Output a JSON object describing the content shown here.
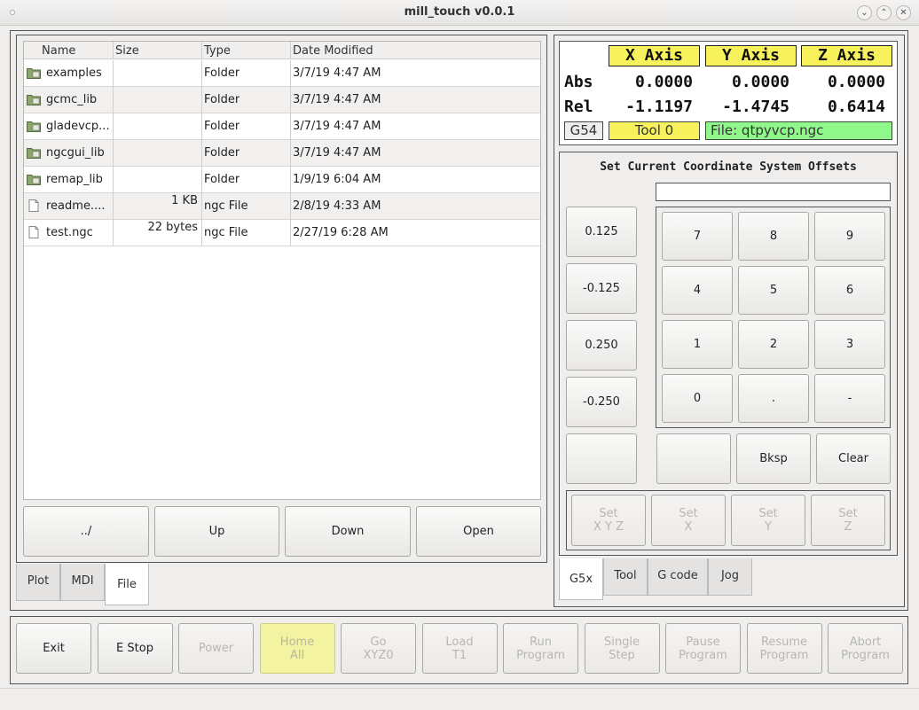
{
  "window": {
    "title": "mill_touch v0.0.1",
    "minimize_glyph": "⌄",
    "maximize_glyph": "⌃",
    "close_glyph": "✕"
  },
  "files": {
    "columns": [
      "Name",
      "Size",
      "Type",
      "Date Modified"
    ],
    "rows": [
      {
        "icon": "folder-icon",
        "name": "examples",
        "size": "",
        "type": "Folder",
        "date": "3/7/19 4:47 AM"
      },
      {
        "icon": "folder-icon",
        "name": "gcmc_lib",
        "size": "",
        "type": "Folder",
        "date": "3/7/19 4:47 AM"
      },
      {
        "icon": "folder-icon",
        "name": "gladevcp...",
        "size": "",
        "type": "Folder",
        "date": "3/7/19 4:47 AM"
      },
      {
        "icon": "folder-icon",
        "name": "ngcgui_lib",
        "size": "",
        "type": "Folder",
        "date": "3/7/19 4:47 AM"
      },
      {
        "icon": "folder-icon",
        "name": "remap_lib",
        "size": "",
        "type": "Folder",
        "date": "1/9/19 6:04 AM"
      },
      {
        "icon": "file-icon",
        "name": "readme....",
        "size": "1 KB",
        "type": "ngc File",
        "date": "2/8/19 4:33 AM"
      },
      {
        "icon": "file-icon",
        "name": "test.ngc",
        "size": "22 bytes",
        "type": "ngc File",
        "date": "2/27/19 6:28 AM"
      }
    ],
    "nav_buttons": [
      "../",
      "Up",
      "Down",
      "Open"
    ]
  },
  "left_tabs": {
    "items": [
      "Plot",
      "MDI",
      "File"
    ],
    "selected": "File"
  },
  "dro": {
    "axes": [
      "X Axis",
      "Y Axis",
      "Z Axis"
    ],
    "abs_label": "Abs",
    "rel_label": "Rel",
    "abs": [
      "0.0000",
      "0.0000",
      "0.0000"
    ],
    "rel": [
      "-1.1197",
      "-1.4745",
      "0.6414"
    ],
    "work_offset": "G54",
    "tool": "Tool 0",
    "file": "File: qtpyvcp.ngc",
    "colors": {
      "axis_header": "#f7f25c",
      "file_bg": "#90f78a"
    }
  },
  "offsets": {
    "title": "Set Current Coordinate System Offsets",
    "entry_value": "",
    "presets": [
      "0.125",
      "-0.125",
      "0.250",
      "-0.250",
      ""
    ],
    "keypad": [
      "7",
      "8",
      "9",
      "4",
      "5",
      "6",
      "1",
      "2",
      "3",
      "0",
      ".",
      "-"
    ],
    "edit_buttons": [
      "",
      "Bksp",
      "Clear"
    ],
    "set_buttons": [
      [
        "Set",
        "X Y Z"
      ],
      [
        "Set",
        "X"
      ],
      [
        "Set",
        "Y"
      ],
      [
        "Set",
        "Z"
      ]
    ]
  },
  "right_tabs": {
    "items": [
      "G5x",
      "Tool",
      "G code",
      "Jog"
    ],
    "selected": "G5x"
  },
  "bottom_buttons": [
    {
      "l1": "Exit",
      "l2": "",
      "state": "enabled"
    },
    {
      "l1": "E Stop",
      "l2": "",
      "state": "enabled"
    },
    {
      "l1": "Power",
      "l2": "",
      "state": "disabled"
    },
    {
      "l1": "Home",
      "l2": "All",
      "state": "highlight"
    },
    {
      "l1": "Go",
      "l2": "XYZ0",
      "state": "disabled"
    },
    {
      "l1": "Load",
      "l2": "T1",
      "state": "disabled"
    },
    {
      "l1": "Run",
      "l2": "Program",
      "state": "disabled"
    },
    {
      "l1": "Single",
      "l2": "Step",
      "state": "disabled"
    },
    {
      "l1": "Pause",
      "l2": "Program",
      "state": "disabled"
    },
    {
      "l1": "Resume",
      "l2": "Program",
      "state": "disabled"
    },
    {
      "l1": "Abort",
      "l2": "Program",
      "state": "disabled"
    }
  ]
}
